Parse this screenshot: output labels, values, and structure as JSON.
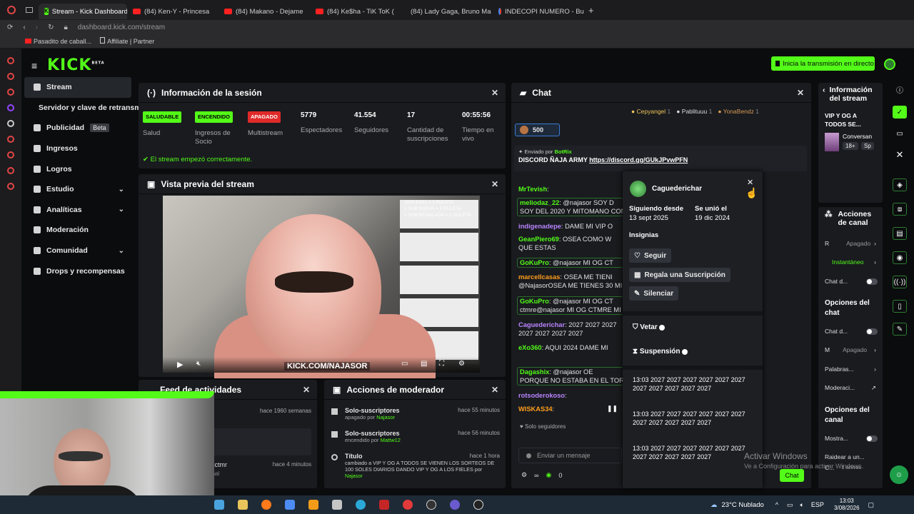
{
  "browser": {
    "tabs": [
      {
        "label": "Stream - Kick Dashboard",
        "icon": "kick-favicon",
        "active": true
      },
      {
        "label": "(84) Ken-Y - Princesa",
        "icon": "youtube-favicon"
      },
      {
        "label": "(84) Makano - Dejame",
        "icon": "youtube-favicon"
      },
      {
        "label": "(84) Ke$ha - TiK ToK (",
        "icon": "youtube-favicon"
      },
      {
        "label": "(84) Lady Gaga, Bruno Ma",
        "icon": "youtube-favicon"
      },
      {
        "label": "INDECOPI NUMERO - Busc",
        "icon": "google-favicon"
      }
    ],
    "url_host": "dashboard.kick.com",
    "url_path": "/stream",
    "bookmarks": [
      "Pasadito de caball...",
      "Affiliate | Partner"
    ]
  },
  "header": {
    "logo": "KICK",
    "logo_sup": "BETA",
    "go_live": "Inicia la transmisión en directo"
  },
  "nav": {
    "items": [
      {
        "label": "Stream",
        "active": true
      },
      {
        "label": "Servidor y clave de retransm"
      },
      {
        "label": "Publicidad",
        "badge": "Beta"
      },
      {
        "label": "Ingresos"
      },
      {
        "label": "Logros"
      },
      {
        "label": "Estudio",
        "chevron": true
      },
      {
        "label": "Analíticas",
        "chevron": true
      },
      {
        "label": "Moderación"
      },
      {
        "label": "Comunidad",
        "chevron": true
      },
      {
        "label": "Drops y recompensas"
      }
    ]
  },
  "session": {
    "title": "Información de la sesión",
    "stats": [
      {
        "badge": "SALUDABLE",
        "label": "Salud",
        "color": "#53fc18"
      },
      {
        "badge": "ENCENDIDO",
        "label": "Ingresos de Socio",
        "color": "#53fc18"
      },
      {
        "badge": "APAGADO",
        "label": "Multistream",
        "color": "#e02a2a"
      },
      {
        "value": "5779",
        "label": "Espectadores"
      },
      {
        "value": "41.554",
        "label": "Seguidores"
      },
      {
        "value": "17",
        "label": "Cantidad de suscripciones"
      },
      {
        "value": "00:55:56",
        "label": "Tiempo en vivo"
      }
    ],
    "status": "El stream empezó correctamente."
  },
  "preview": {
    "title": "Vista previa del stream",
    "overlay": "1000 Kicks = 1 RULETA\n1 SUB NUEVA = 1 RULETA\n1 SUB REGALADA = 1 RULETA",
    "watermark": "KICK.COM/NAJASOR"
  },
  "activity": {
    "title": "Feed de actividades",
    "items": [
      {
        "time": "hace 1960 semanas"
      },
      {
        "text": "rasctmr",
        "sub": "canal",
        "time": "hace 4 minutos"
      }
    ]
  },
  "modactions": {
    "title": "Acciones de moderador",
    "items": [
      {
        "title": "Solo-suscriptores",
        "detail_pre": "apagado por ",
        "who": "Najasor",
        "time": "hace 55 minutos"
      },
      {
        "title": "Solo-suscriptores",
        "detail_pre": "encendido por ",
        "who": "Mattw12",
        "time": "hace 56 minutos"
      },
      {
        "title": "Título",
        "detail_pre": "cambiado a VIP Y OG A TODOS SE VIENEN LOS SORTEOS DE 100 SOLES DIARIOS DANDO VIP Y OG A LOS FIELES por ",
        "who": "Najasor",
        "time": "hace 1 hora"
      }
    ]
  },
  "chat": {
    "title": "Chat",
    "top_gifters": [
      {
        "name": "Cepyangel",
        "rank": "1"
      },
      {
        "name": "Pablituuu",
        "rank": "1"
      },
      {
        "name": "YonaBendz",
        "rank": "1"
      }
    ],
    "kicks_counter": "500",
    "pinned_sender": "Enviado por",
    "pinned_user": "BotRix",
    "pinned_text_pre": "DISCORD ÑAJA ARMY ",
    "pinned_link": "https://discord.gg/GUkJPvwPFN",
    "messages": [
      {
        "user": "MrTevish",
        "text": ":",
        "color": "#53fc18"
      },
      {
        "user": "meliodaz_22",
        "text": ": @najasor SOY D",
        "extra": "SOY DEL 2020 Y MITOMANO CON",
        "color": "#53fc18"
      },
      {
        "user": "indigenadepe",
        "text": ": DAME MI VIP O",
        "color": "#b985ff"
      },
      {
        "user": "GeanPiero69",
        "text": ": OSEA COMO W",
        "extra": "QUE ESTAS",
        "color": "#53fc18"
      },
      {
        "user": "GoKuPro",
        "text": ": @najasor MI OG CT",
        "color": "#53fc18"
      },
      {
        "user": "marcellcasas",
        "text": ": OSEA ME TIENI",
        "extra": "@NajasorOSEA ME TIENES 30 MI",
        "color": "#ff9d1c"
      },
      {
        "user": "GoKuPro",
        "text": ": @najasor MI OG CT",
        "extra": "ctmre@najasor MI OG CTMRE MI",
        "color": "#53fc18"
      },
      {
        "user": "Caguederichar",
        "text": ": 2027  2027  2027",
        "extra": "2027  2027  2027  2027",
        "color": "#b985ff"
      },
      {
        "user": "eXo360",
        "text": ": AQUI 2024 DAME MI",
        "color": "#53fc18"
      },
      {
        "user": "Dagashix",
        "text": ": @najasor OE",
        "extra": "PORQUE NO ESTABA EN EL TORN",
        "color": "#53fc18"
      },
      {
        "user": "rotsoderokoso",
        "text": ":",
        "color": "#b985ff"
      },
      {
        "user": "WISKAS34",
        "text": ":",
        "color": "#ff9d1c"
      }
    ],
    "followers_only": "Solo seguidores",
    "input_placeholder": "Enviar un mensaje",
    "points": "0",
    "send_label": "Chat"
  },
  "usercard": {
    "username": "Caguederichar",
    "following_label": "Siguiendo desde",
    "following_date": "13 sept 2025",
    "joined_label": "Se unió el",
    "joined_date": "19 dic 2024",
    "badges_label": "Insignias",
    "follow_btn": "Seguir",
    "gift_btn": "Regala una Suscripción",
    "mute_btn": "Silenciar",
    "ban_label": "Vetar",
    "timeout_label": "Suspensión",
    "history": [
      {
        "time": "13:03",
        "text": "2027  2027  2027  2027  2027  2027  2027  2027  2027  2027  2027"
      },
      {
        "time": "13:03",
        "text": "2027  2027  2027  2027  2027  2027  2027  2027  2027  2027  2027"
      },
      {
        "time": "13:03",
        "text": "2027  2027  2027  2027  2027  2027  2027  2027  2027  2027  2027"
      }
    ]
  },
  "streaminfo": {
    "title": "Información del stream",
    "stream_title": "VIP Y OG A TODOS SE...",
    "category": "Conversan",
    "tags": [
      "18+",
      "Sp"
    ]
  },
  "channelactions": {
    "title": "Acciones de canal",
    "rows": [
      {
        "label": "R",
        "value": "Apagado"
      },
      {
        "label": "Instantáneo"
      },
      {
        "label": "Chat d..."
      }
    ],
    "chat_options_title": "Opciones del chat",
    "chat_rows": [
      {
        "label": "Chat d..."
      },
      {
        "label": "M",
        "value": "Apagado"
      },
      {
        "label": "Palabras..."
      },
      {
        "label": "Moderaci..."
      }
    ],
    "channel_options_title": "Opciones del canal",
    "channel_rows": [
      {
        "label": "Mostra..."
      },
      {
        "label": "Raidear a un..."
      },
      {
        "label": "C...",
        "value": "1 activas"
      }
    ]
  },
  "watermark_os": {
    "line1": "Activar Windows",
    "line2": "Ve a Configuración para activar Windows."
  },
  "taskbar": {
    "weather": "23°C  Nublado",
    "lang": "ESP",
    "time": "13:03",
    "date": "3/08/2026"
  }
}
